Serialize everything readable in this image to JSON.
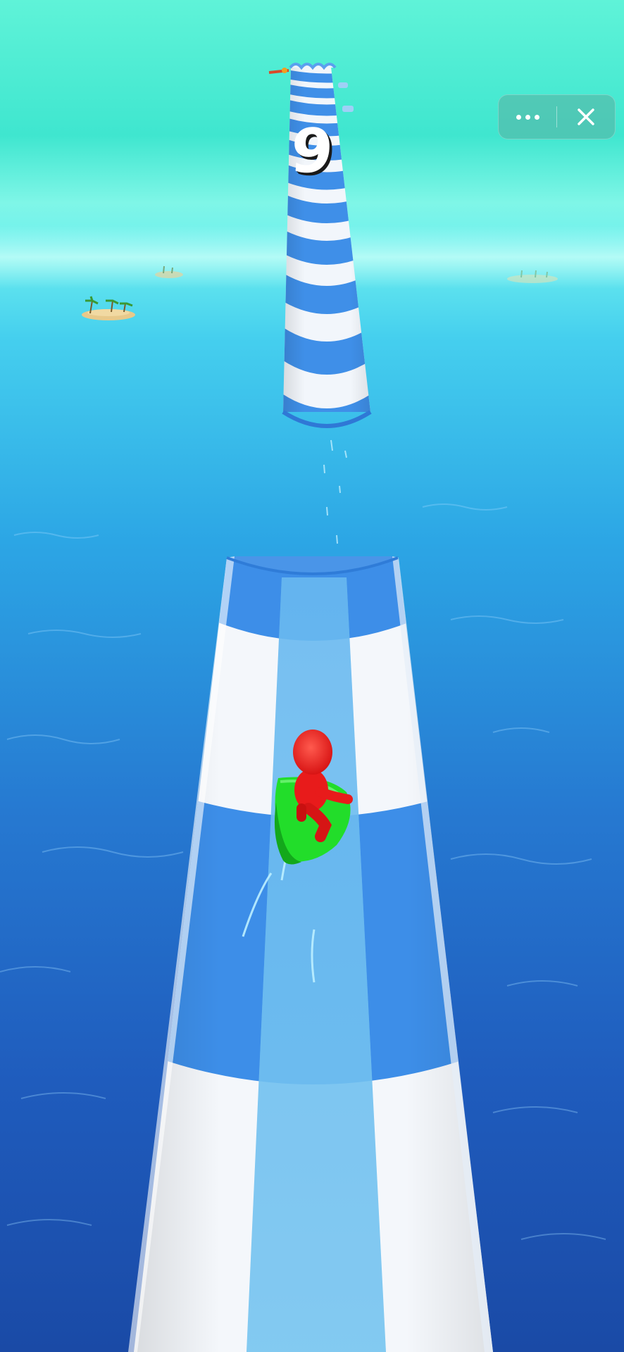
{
  "hud": {
    "level_number": "9"
  },
  "mini_program_menu": {
    "more_icon": "more-dots-icon",
    "close_icon": "close-icon"
  },
  "colors": {
    "sky_top": "#5ff3d8",
    "sea_far": "#58d9ee",
    "sea_near": "#1b4fae",
    "slide_blue": "#3f8fe8",
    "slide_white": "#f5f8fc",
    "player_red": "#ee1c1c",
    "tube_green": "#22dd2a"
  }
}
